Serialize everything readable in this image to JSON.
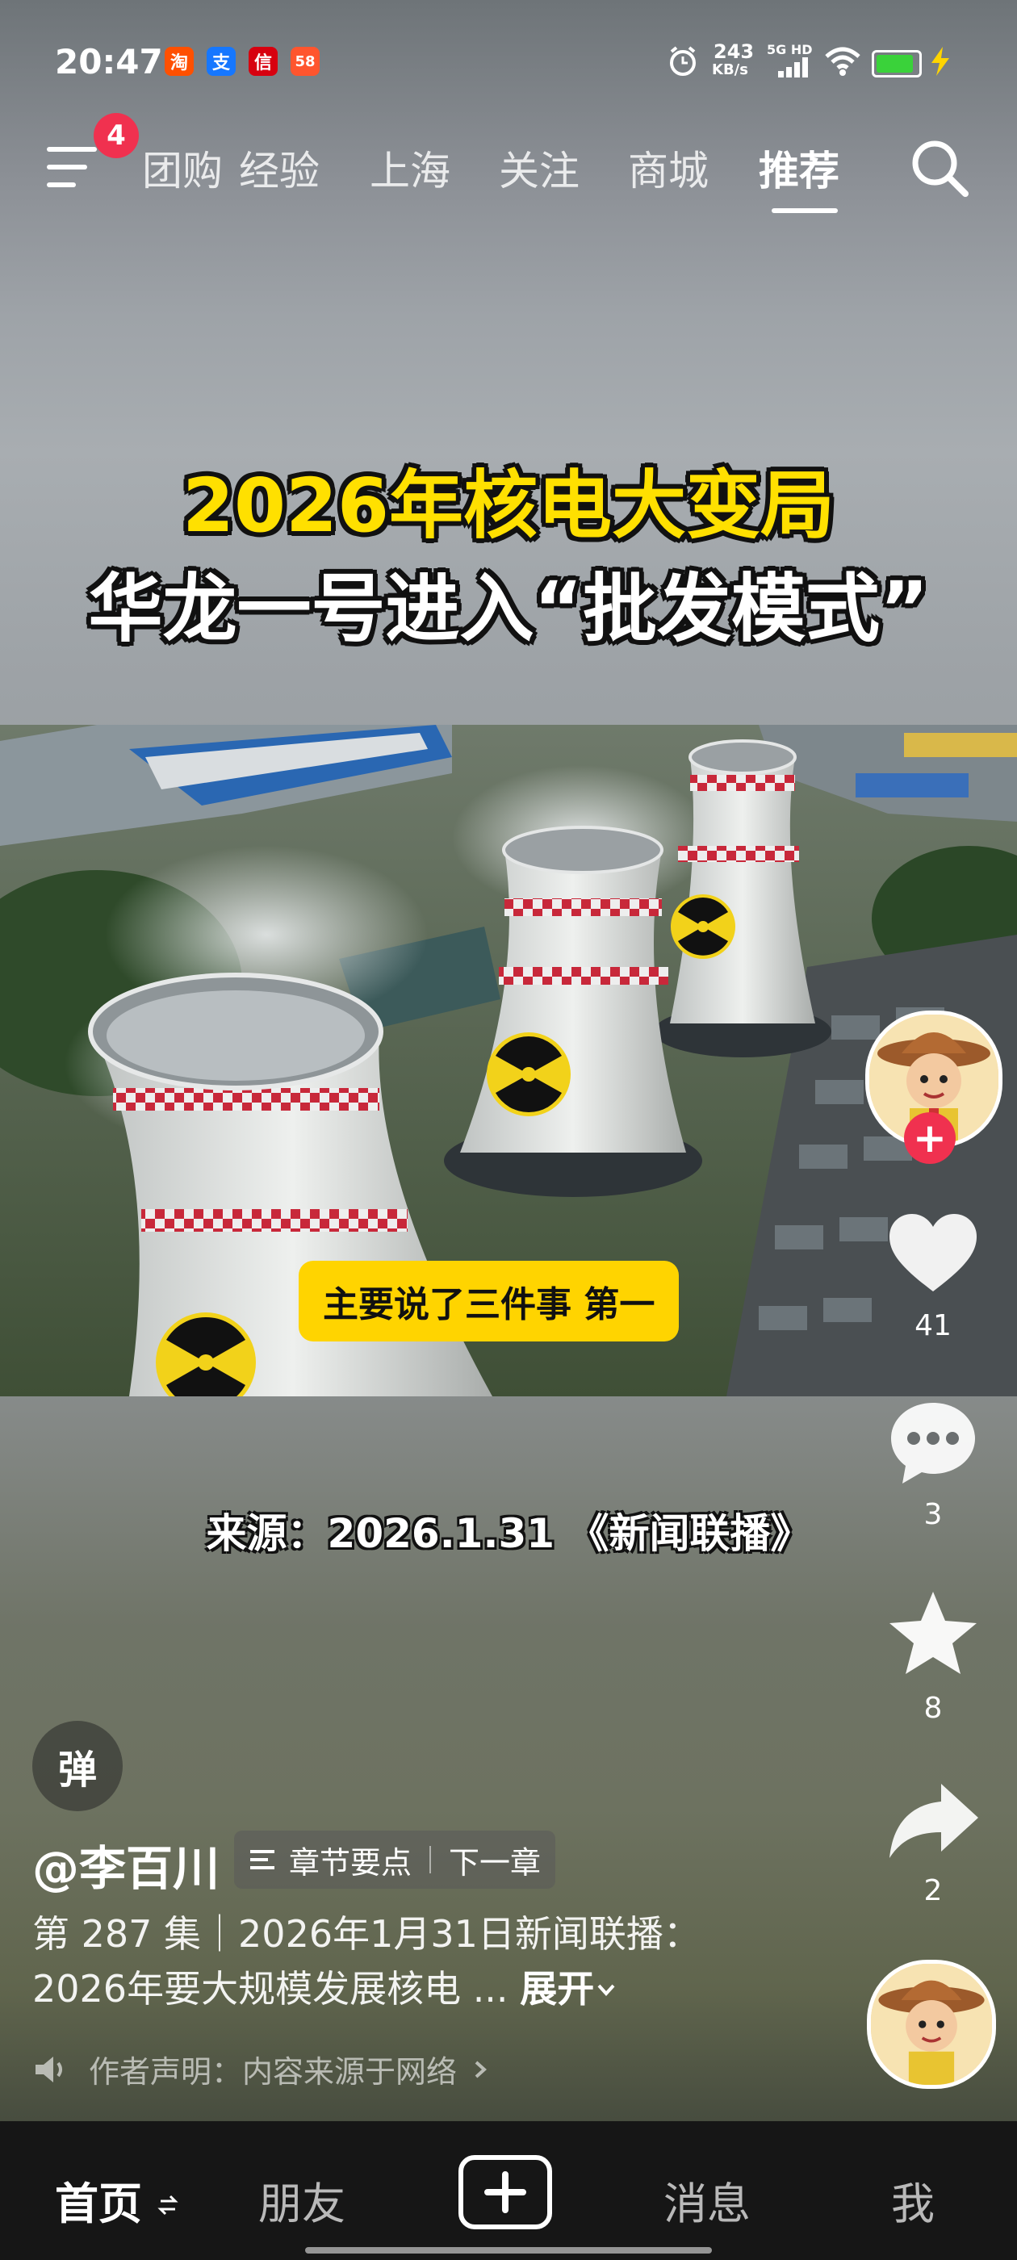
{
  "status_bar": {
    "time": "20:47",
    "apps": [
      {
        "name": "taobao-icon",
        "glyph": "淘",
        "color": "#ff5000"
      },
      {
        "name": "alipay-icon",
        "glyph": "支",
        "color": "#1677ff"
      },
      {
        "name": "citic-icon",
        "glyph": "信",
        "color": "#d7000f"
      },
      {
        "name": "app58-icon",
        "glyph": "58",
        "color": "#ff552e"
      }
    ],
    "net_speed": "243",
    "net_unit": "KB/s",
    "network": "5G HD",
    "battery_level": 0.9
  },
  "nav": {
    "badge": "4",
    "tabs": [
      {
        "label": "团购"
      },
      {
        "label": "经验"
      },
      {
        "label": "上海"
      },
      {
        "label": "关注"
      },
      {
        "label": "商城"
      },
      {
        "label": "推荐",
        "active": true
      }
    ]
  },
  "video": {
    "headline_line1": "2026年核电大变局",
    "headline_line2": "华龙一号进入“批发模式”",
    "subtitle": "主要说了三件事 第一",
    "source": "来源：2026.1.31 《新闻联播》"
  },
  "actions": {
    "likes": "41",
    "comments": "3",
    "favorites": "8",
    "shares": "2"
  },
  "danmaku_label": "弹",
  "author": {
    "name": "@李百川",
    "chapter_label": "章节要点",
    "next_chapter": "下一章"
  },
  "description": {
    "line1": "第 287 集｜2026年1月31日新闻联播：",
    "line2": "2026年要大规模发展核电 ...",
    "expand": "展开"
  },
  "declaration": "作者声明：内容来源于网络",
  "bottom_tabs": {
    "home": "首页",
    "friends": "朋友",
    "messages": "消息",
    "me": "我"
  },
  "colors": {
    "accent_red": "#f0314f",
    "subtitle_yellow": "#ffd400",
    "headline_yellow": "#ffe000"
  }
}
